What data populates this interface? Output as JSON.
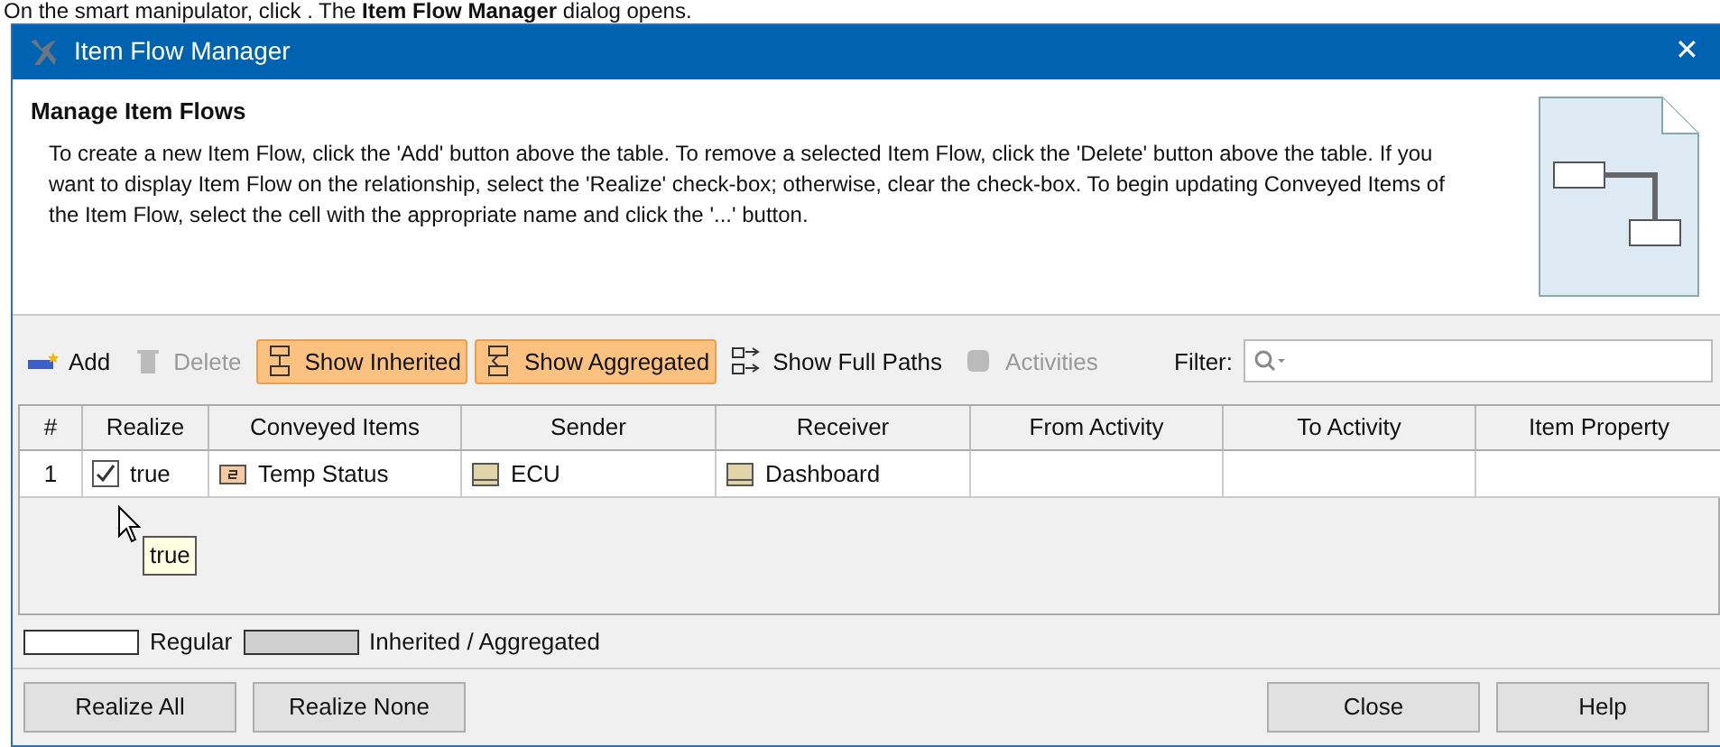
{
  "intro": "On the smart manipulator, click  . The **Item Flow Manager** dialog opens.",
  "window": {
    "title": "Item Flow Manager",
    "close": "✕"
  },
  "header": {
    "title": "Manage Item Flows",
    "description": "To create a new Item Flow, click the 'Add' button above the table. To remove a selected Item Flow, click the 'Delete' button above the table. If you want to display Item Flow on the relationship, select the 'Realize' check-box; otherwise, clear the check-box. To begin updating Conveyed Items of the Item Flow, select the cell with the appropriate name and click the '...' button."
  },
  "toolbar": [
    {
      "kind": "add",
      "label": "Add",
      "disabled": false,
      "on": false
    },
    {
      "kind": "delete",
      "label": "Delete",
      "disabled": true,
      "on": false
    },
    {
      "kind": "inherited",
      "label": "Show Inherited",
      "disabled": false,
      "on": true
    },
    {
      "kind": "aggregated",
      "label": "Show Aggregated",
      "disabled": false,
      "on": true
    },
    {
      "kind": "paths",
      "label": "Show Full Paths",
      "disabled": false,
      "on": false
    },
    {
      "kind": "activities",
      "label": "Activities",
      "disabled": true,
      "on": false
    }
  ],
  "filter": {
    "label": "Filter:"
  },
  "table": {
    "columns": [
      "#",
      "Realize",
      "Conveyed Items",
      "Sender",
      "Receiver",
      "From Activity",
      "To Activity",
      "Item Property"
    ],
    "rows": [
      {
        "number": "1",
        "realize": {
          "checked": true,
          "text": "true"
        },
        "conveyed_items": "Temp Status",
        "sender": "ECU",
        "receiver": "Dashboard"
      }
    ]
  },
  "tooltip": "true",
  "legend": [
    "Regular",
    "Inherited / Aggregated"
  ],
  "buttons_left": [
    "Realize All",
    "Realize None"
  ],
  "buttons_right": [
    "Close",
    "Help"
  ]
}
